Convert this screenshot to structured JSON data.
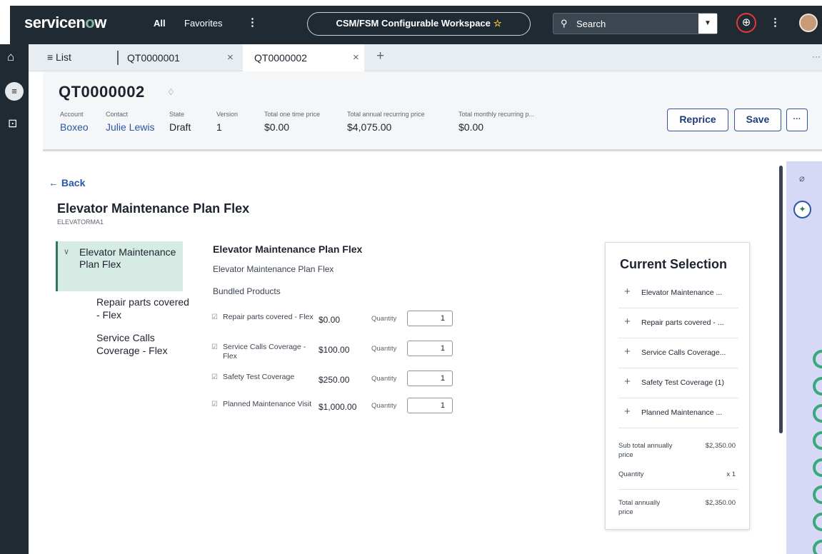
{
  "topbar": {
    "brand_text": "servicen",
    "brand_o": "o",
    "brand_tail": "w",
    "all_label": "All",
    "favorites_label": "Favorites",
    "more_glyph": "⋮",
    "workspace_label": "CSM/FSM Configurable Workspace",
    "star_glyph": "☆",
    "search_placeholder": "Search",
    "search_glyph": "⚲",
    "dropdown_glyph": "▼",
    "globe_glyph": "⊕",
    "kebab_glyph": "⋮"
  },
  "rail": {
    "home_glyph": "⌂",
    "list_glyph": "≡",
    "inbox_glyph": "⊡"
  },
  "tabs": {
    "list_label": "≡ List",
    "items": [
      {
        "label": "QT0000001",
        "close": "×"
      },
      {
        "label": "QT0000002",
        "close": "×"
      }
    ],
    "plus_glyph": "+",
    "more_glyph": "···"
  },
  "record": {
    "number": "QT0000002",
    "tag_glyph": "♢",
    "fields": [
      {
        "label": "Account",
        "value": "Boxeo"
      },
      {
        "label": "Contact",
        "value": "Julie Lewis"
      },
      {
        "label": "State",
        "value": "Draft"
      },
      {
        "label": "Version",
        "value": "1"
      },
      {
        "label": "Total one time price",
        "value": "$0.00"
      },
      {
        "label": "Total annual recurring price",
        "value": "$4,075.00"
      },
      {
        "label": "Total monthly recurring p...",
        "value": "$0.00"
      }
    ],
    "reprice_label": "Reprice",
    "save_label": "Save",
    "more_label": "···"
  },
  "config": {
    "back_label": "← Back",
    "product_title": "Elevator Maintenance Plan Flex",
    "product_code": "ELEVATORMA1",
    "tree": {
      "chevron": "∨",
      "root": "Elevator Maintenance Plan Flex",
      "children": [
        "Repair parts covered - Flex",
        "Service Calls Coverage - Flex"
      ]
    },
    "panel_title": "Elevator Maintenance Plan Flex",
    "panel_desc": "Elevator Maintenance Plan Flex",
    "bundled_label": "Bundled Products",
    "check_glyph": "☑",
    "quantity_label": "Quantity",
    "bundled": [
      {
        "name": "Repair parts covered - Flex",
        "price": "$0.00",
        "qty": "1"
      },
      {
        "name": "Service Calls Coverage - Flex",
        "price": "$100.00",
        "qty": "1"
      },
      {
        "name": "Safety Test Coverage",
        "price": "$250.00",
        "qty": "1"
      },
      {
        "name": "Planned Maintenance Visit",
        "price": "$1,000.00",
        "qty": "1"
      }
    ]
  },
  "selection": {
    "title": "Current Selection",
    "plus_glyph": "+",
    "items": [
      "Elevator Maintenance ...",
      "Repair parts covered - ...",
      "Service Calls Coverage...",
      "Safety Test Coverage (1)",
      "Planned Maintenance ..."
    ],
    "subtotal_label": "Sub total annually price",
    "subtotal_value": "$2,350.00",
    "quantity_label": "Quantity",
    "quantity_value": "x 1",
    "total_label": "Total annually price",
    "total_value": "$2,350.00"
  },
  "rightrail": {
    "clip_glyph": "⌀",
    "assist_glyph": "✦"
  },
  "colors": {
    "nav_bg": "#1f2a33",
    "link": "#2b58a6",
    "selected_tree": "#d6ebe3",
    "rail": "#d5d9f5",
    "accent_green": "#2c7a58"
  }
}
